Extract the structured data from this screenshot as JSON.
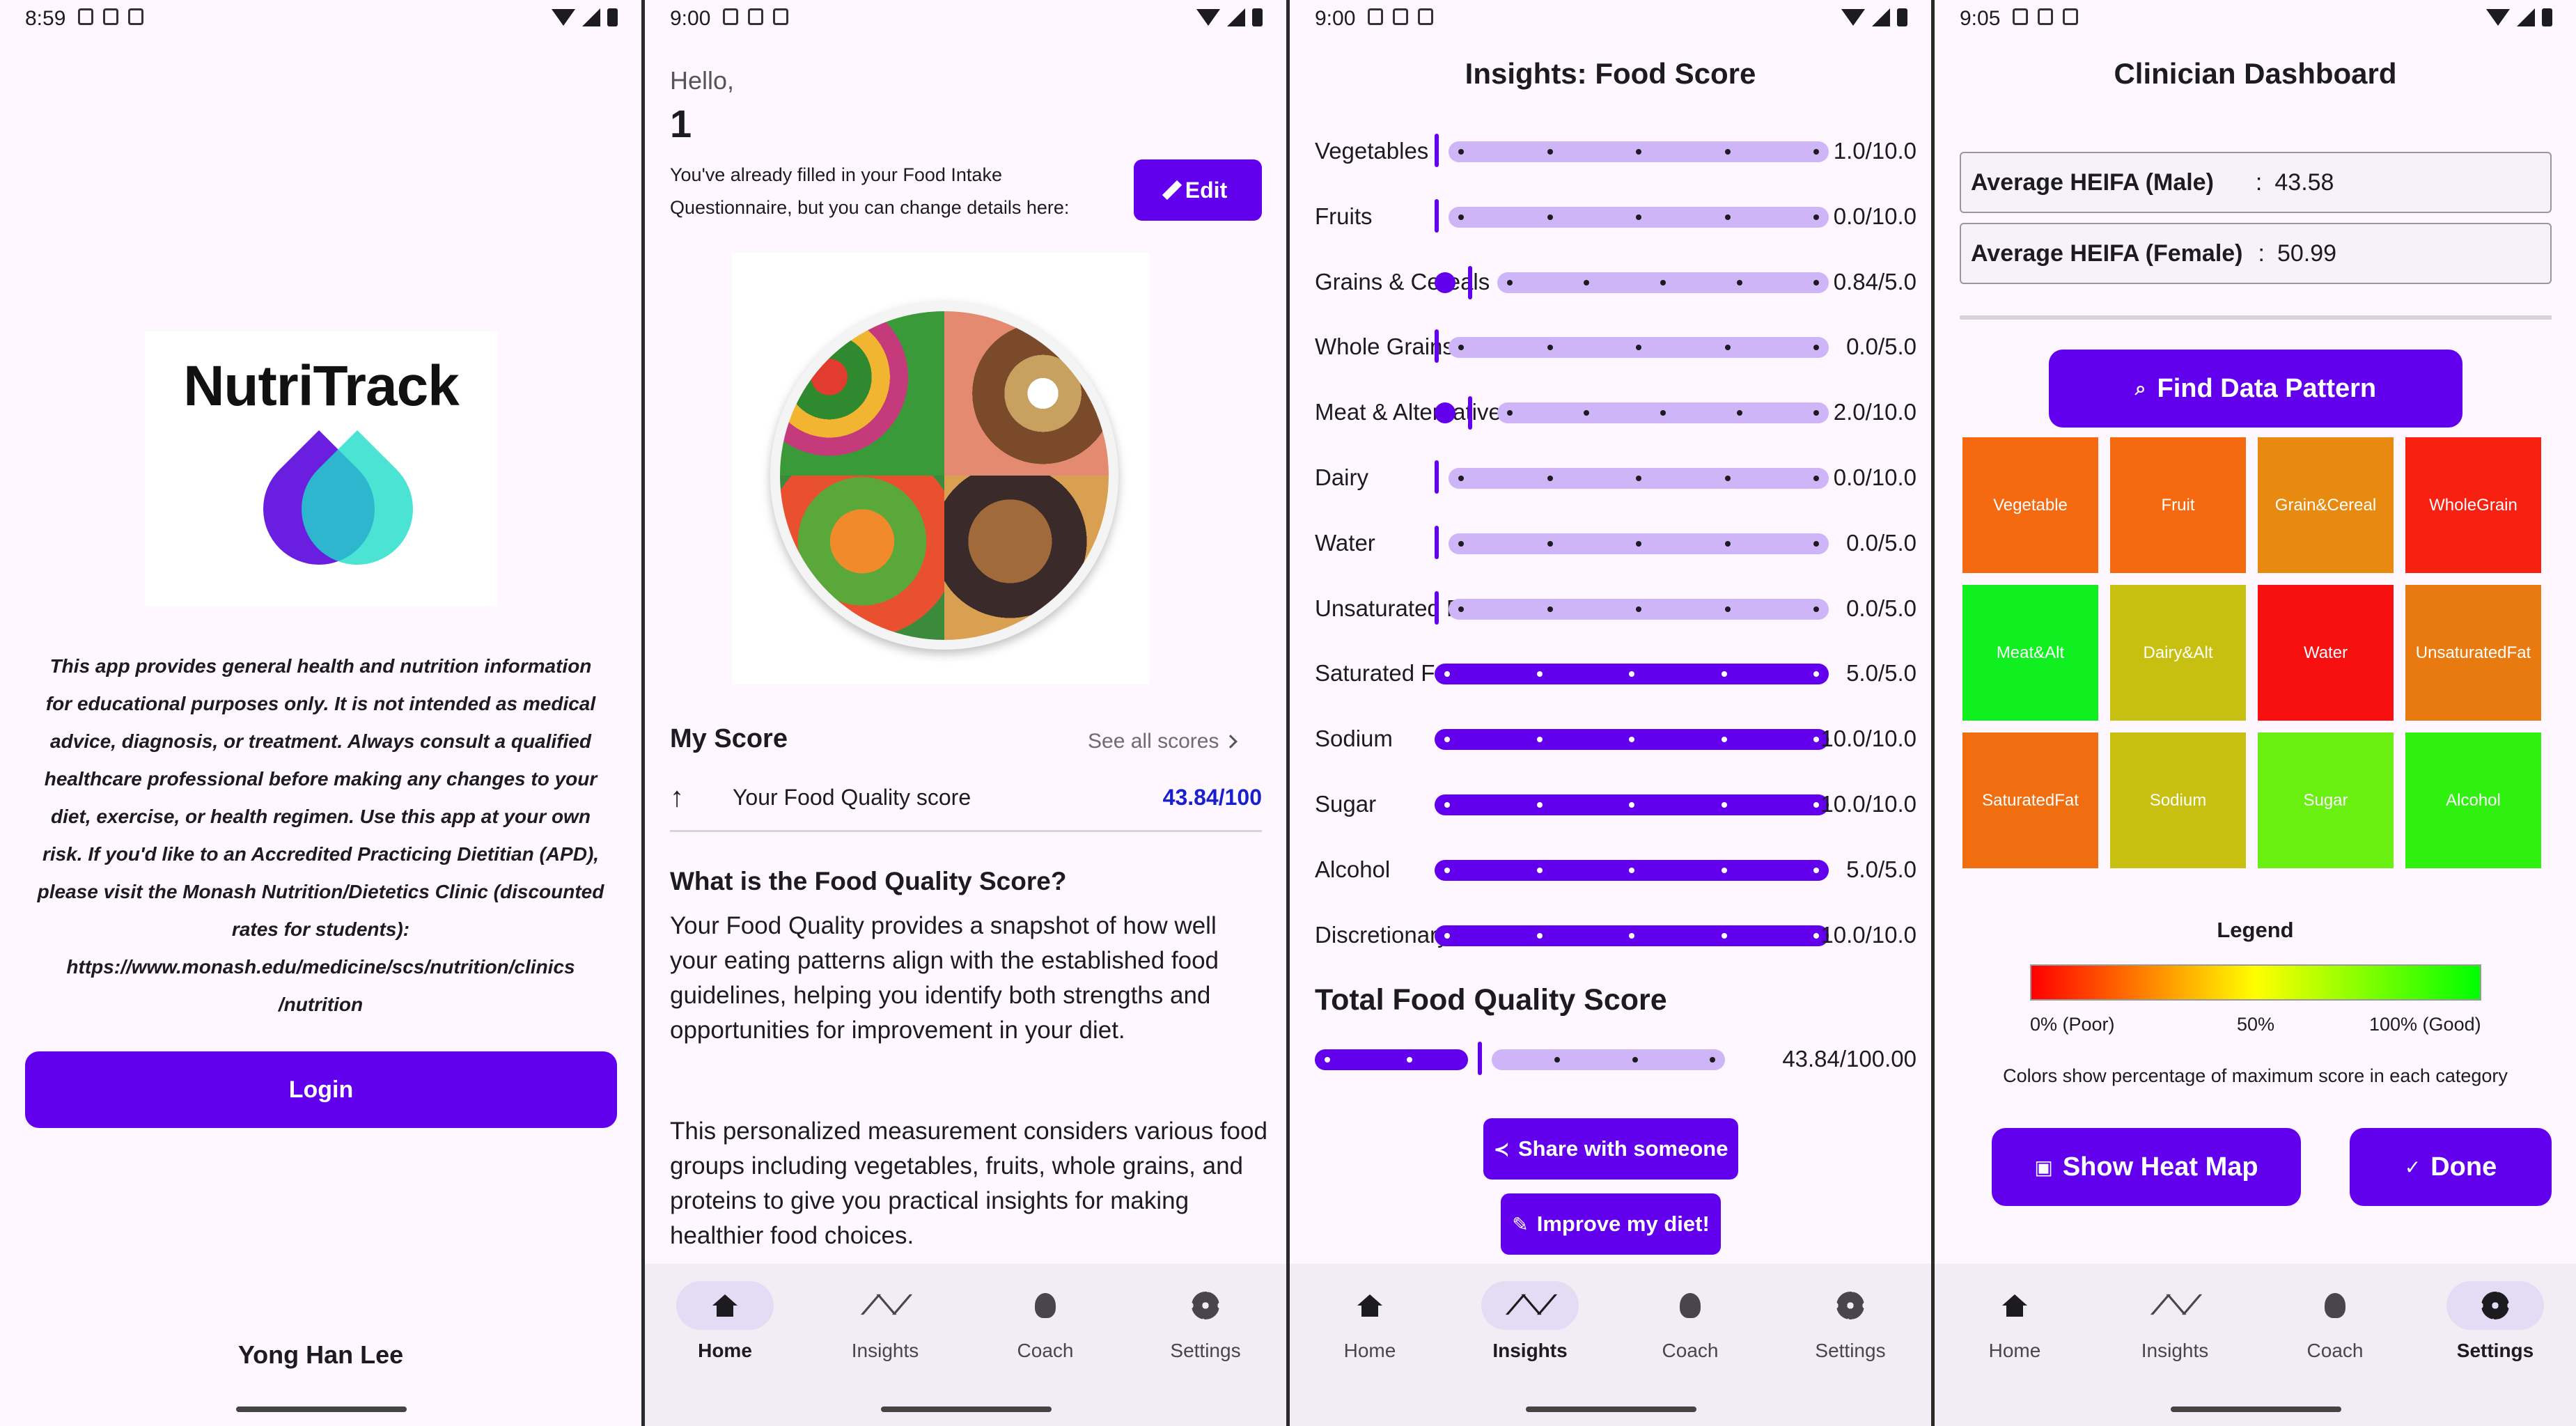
{
  "screen1": {
    "status_time": "8:59",
    "logo_text": "NutriTrack",
    "disclaimer": "This app provides general health and nutrition information for educational purposes only. It is not intended as medical advice, diagnosis, or treatment. Always consult a qualified healthcare professional before making any changes to your diet, exercise, or health regimen. Use this app at your own risk. If you'd like to an Accredited Practicing Dietitian (APD), please visit the Monash Nutrition/Dietetics Clinic (discounted rates for students): https://www.monash.edu/medicine/scs/nutrition/clinics /nutrition",
    "login_label": "Login",
    "author": "Yong Han Lee"
  },
  "screen2": {
    "status_time": "9:00",
    "greeting": "Hello,",
    "user_name": "1",
    "questionnaire_note": "You've already filled in your Food Intake Questionnaire, but you can change details here:",
    "edit_label": "Edit",
    "my_score_title": "My Score",
    "see_all_label": "See all scores",
    "score_label": "Your Food Quality score",
    "score_value": "43.84/100",
    "what_title": "What is the Food Quality Score?",
    "what_para1": "Your Food Quality provides a snapshot of how well your eating patterns align with the established food guidelines, helping you identify both strengths and opportunities for improvement in your diet.",
    "what_para2": "This personalized measurement considers various food groups including vegetables, fruits, whole grains, and proteins to give you practical insights for making healthier food choices."
  },
  "screen3": {
    "status_time": "9:00",
    "title": "Insights: Food Score",
    "scores": [
      {
        "label": "Vegetables",
        "value": "1.0/10.0",
        "fraction": 0.1
      },
      {
        "label": "Fruits",
        "value": "0.0/10.0",
        "fraction": 0.0
      },
      {
        "label": "Grains & Cereals",
        "value": "0.84/5.0",
        "fraction": 0.17
      },
      {
        "label": "Whole Grains",
        "value": "0.0/5.0",
        "fraction": 0.0
      },
      {
        "label": "Meat & Alternatives",
        "value": "2.0/10.0",
        "fraction": 0.2
      },
      {
        "label": "Dairy",
        "value": "0.0/10.0",
        "fraction": 0.0
      },
      {
        "label": "Water",
        "value": "0.0/5.0",
        "fraction": 0.0
      },
      {
        "label": "Unsaturated Fats",
        "value": "0.0/5.0",
        "fraction": 0.0
      },
      {
        "label": "Saturated Fats",
        "value": "5.0/5.0",
        "fraction": 1.0
      },
      {
        "label": "Sodium",
        "value": "10.0/10.0",
        "fraction": 1.0
      },
      {
        "label": "Sugar",
        "value": "10.0/10.0",
        "fraction": 1.0
      },
      {
        "label": "Alcohol",
        "value": "5.0/5.0",
        "fraction": 1.0
      },
      {
        "label": "Discretionary Foods",
        "value": "10.0/10.0",
        "fraction": 1.0
      }
    ],
    "total_title": "Total Food Quality Score",
    "total_value": "43.84/100.00",
    "total_fraction": 0.4384,
    "share_label": "Share with someone",
    "improve_label": "Improve my diet!"
  },
  "screen4": {
    "status_time": "9:05",
    "title": "Clinician Dashboard",
    "avg_male_label": "Average HEIFA (Male)",
    "avg_male_value": "43.58",
    "avg_female_label": "Average HEIFA (Female)",
    "avg_female_value": "50.99",
    "colon": ":",
    "find_label": "Find Data Pattern",
    "heatmap": [
      {
        "label": "Vegetable",
        "color": "#f56a10"
      },
      {
        "label": "Fruit",
        "color": "#f56a10"
      },
      {
        "label": "Grain&Cereal",
        "color": "#e88a10"
      },
      {
        "label": "WholeGrain",
        "color": "#f82010"
      },
      {
        "label": "Meat&Alt",
        "color": "#10f020"
      },
      {
        "label": "Dairy&Alt",
        "color": "#c8c010"
      },
      {
        "label": "Water",
        "color": "#f81010"
      },
      {
        "label": "UnsaturatedFat",
        "color": "#e87a10"
      },
      {
        "label": "SaturatedFat",
        "color": "#f06e10"
      },
      {
        "label": "Sodium",
        "color": "#c8c010"
      },
      {
        "label": "Sugar",
        "color": "#6af010"
      },
      {
        "label": "Alcohol",
        "color": "#30f010"
      }
    ],
    "legend_title": "Legend",
    "legend_poor": "0% (Poor)",
    "legend_mid": "50%",
    "legend_good": "100% (Good)",
    "legend_note": "Colors show percentage of maximum score in each category",
    "heatmap_btn": "Show Heat Map",
    "done_btn": "Done"
  },
  "nav": {
    "home": "Home",
    "insights": "Insights",
    "coach": "Coach",
    "settings": "Settings"
  },
  "colors": {
    "primary": "#6200ee",
    "track_light": "#cdb5f8",
    "background": "#fef7ff"
  }
}
